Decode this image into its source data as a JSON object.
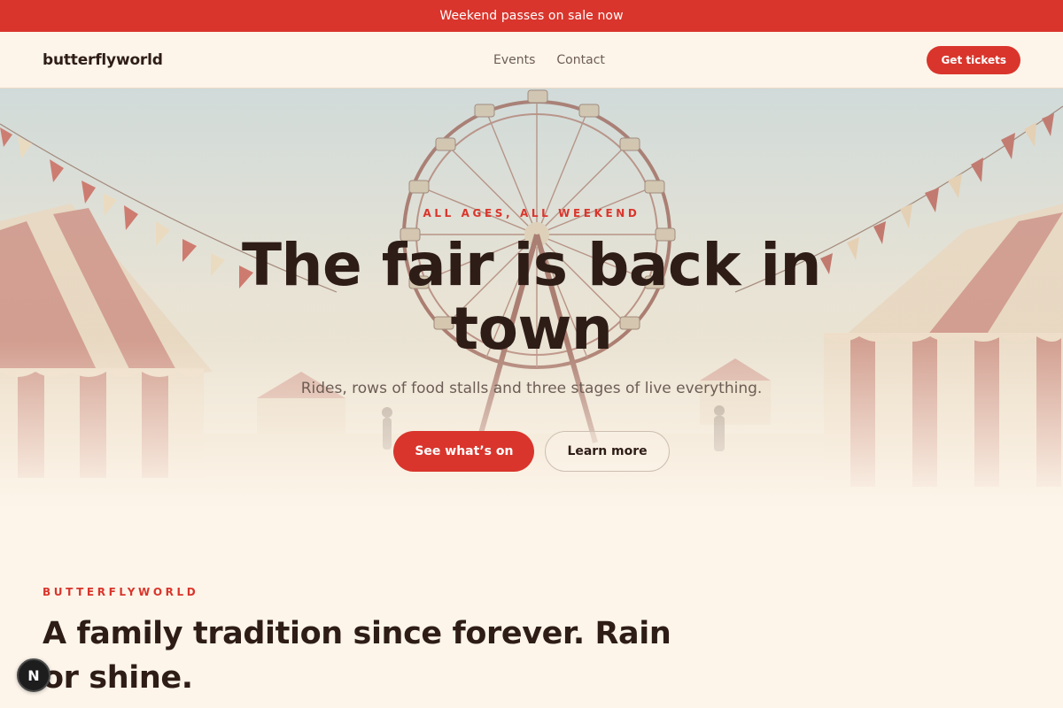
{
  "announcement": {
    "text": "Weekend passes on sale now"
  },
  "header": {
    "logo": "butterflyworld",
    "nav": [
      {
        "label": "Events"
      },
      {
        "label": "Contact"
      }
    ],
    "cta_label": "Get tickets"
  },
  "hero": {
    "eyebrow": "ALL AGES, ALL WEEKEND",
    "title": "The fair is back in town",
    "subtitle": "Rides, rows of food stalls and three stages of live everything.",
    "primary_cta": "See what’s on",
    "secondary_cta": "Learn more",
    "image_subject": "vintage fairground with ferris wheel, striped tents and bunting"
  },
  "intro": {
    "eyebrow": "BUTTERFLYWORLD",
    "title": "A family tradition since forever. Rain or shine."
  },
  "dev_badge": {
    "letter": "N"
  },
  "colors": {
    "accent": "#d9352c",
    "background": "#fdf5ea",
    "text": "#2e1d17",
    "muted": "#6d5d55"
  }
}
